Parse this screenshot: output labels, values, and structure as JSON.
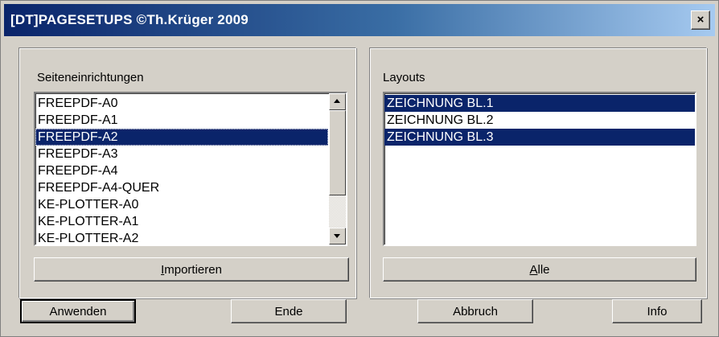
{
  "window": {
    "title": "[DT]PAGESETUPS ©Th.Krüger 2009",
    "close_label": "×"
  },
  "left_panel": {
    "label": "Seiteneinrichtungen",
    "items": [
      "FREEPDF-A0",
      "FREEPDF-A1",
      "FREEPDF-A2",
      "FREEPDF-A3",
      "FREEPDF-A4",
      "FREEPDF-A4-QUER",
      "KE-PLOTTER-A0",
      "KE-PLOTTER-A1",
      "KE-PLOTTER-A2"
    ],
    "selected_item": "FREEPDF-A2",
    "import_button": {
      "accel": "I",
      "rest": "mportieren"
    }
  },
  "right_panel": {
    "label": "Layouts",
    "items": [
      "ZEICHNUNG BL.1",
      "ZEICHNUNG BL.2",
      "ZEICHNUNG BL.3"
    ],
    "selected_items": [
      "ZEICHNUNG BL.1",
      "ZEICHNUNG BL.3"
    ],
    "all_button": {
      "accel": "A",
      "rest": "lle"
    }
  },
  "buttons": {
    "apply": "Anwenden",
    "end": "Ende",
    "cancel": "Abbruch",
    "info": "Info"
  },
  "colors": {
    "selection": "#0a246a",
    "dialog_bg": "#d4d0c8"
  }
}
